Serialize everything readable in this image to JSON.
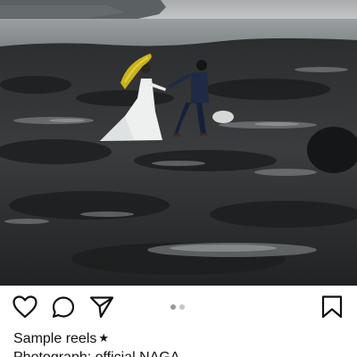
{
  "post": {
    "image_alt": "Bride and groom walking across dark volcanic rock shore with yellow bouquet",
    "carousel": {
      "total": 2,
      "active_index": 0
    }
  },
  "actions": {
    "like_icon": "heart-outline-icon",
    "comment_icon": "speech-bubble-icon",
    "share_icon": "paper-plane-icon",
    "save_icon": "bookmark-outline-icon"
  },
  "caption": {
    "username": "Sample reels",
    "username_star": "★",
    "text": "Photograph: official NAGA"
  }
}
